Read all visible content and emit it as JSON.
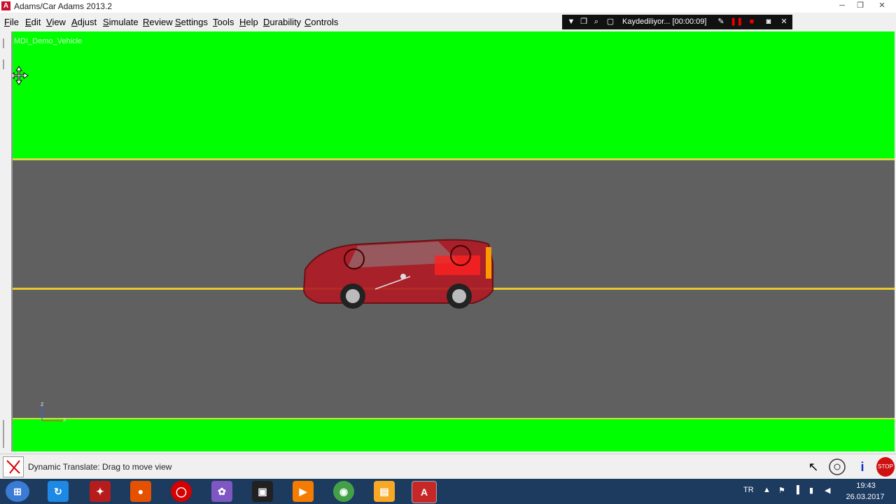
{
  "window": {
    "title": "Adams/Car Adams 2013.2",
    "app_icon_letter": "A",
    "controls": [
      "minimize-icon",
      "restore-icon",
      "close-icon"
    ]
  },
  "menu": [
    "File",
    "Edit",
    "View",
    "Adjust",
    "Simulate",
    "Review",
    "Settings",
    "Tools",
    "Help",
    "Durability",
    "Controls"
  ],
  "recorder": {
    "status": "Kaydediliyor... [00:00:09]",
    "icons": [
      "chevron-down-icon",
      "window-icon",
      "zoom-icon",
      "region-icon",
      "pencil-icon",
      "pause-icon",
      "stop-icon",
      "camera-icon",
      "close-icon"
    ]
  },
  "viewport": {
    "model_name": "MDI_Demo_Vehicle",
    "triad_z": "z",
    "triad_x": "x",
    "colors": {
      "grass": "#00ff00",
      "road": "#606060",
      "lane": "#e8c830",
      "car": "#c8102e"
    }
  },
  "status": {
    "text": "Dynamic Translate: Drag to move view",
    "icons": [
      "select-arrow-icon",
      "wheel-icon",
      "info-icon",
      "stop-icon"
    ],
    "info_glyph": "i",
    "stop_glyph": "STOP"
  },
  "taskbar": {
    "apps": [
      "start-icon",
      "refresh-app-icon",
      "game-app-icon",
      "firefox-icon",
      "opera-icon",
      "paint-app-icon",
      "game2-app-icon",
      "media-player-icon",
      "chrome-icon",
      "file-explorer-icon",
      "adams-icon"
    ],
    "adams_letter": "A",
    "language": "TR",
    "time": "19:43",
    "date": "26.03.2017"
  }
}
